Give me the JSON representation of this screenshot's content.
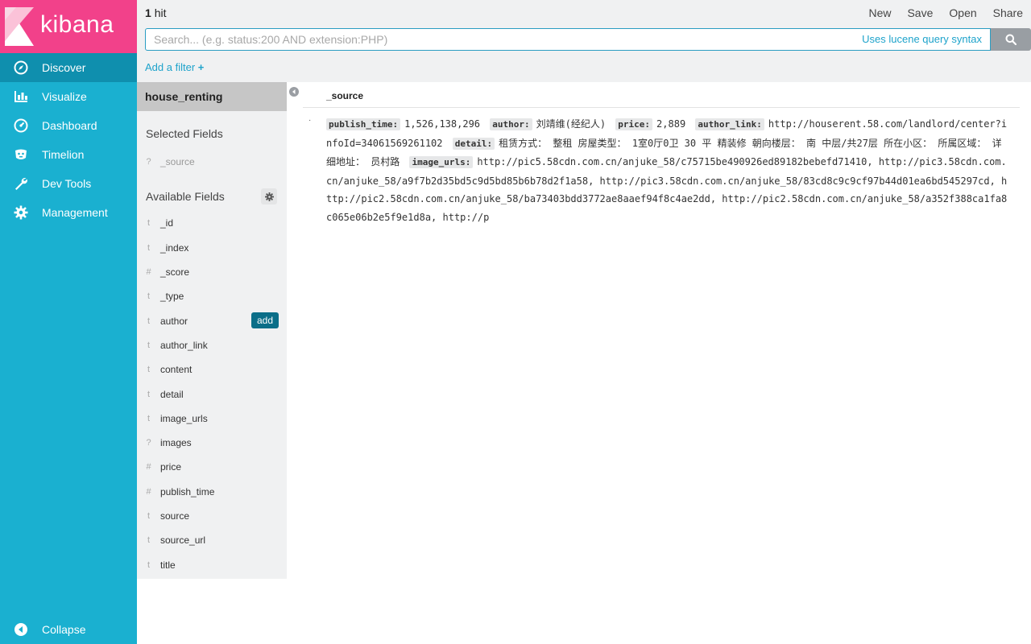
{
  "app": {
    "logo_text": "kibana"
  },
  "sidebar": {
    "items": [
      {
        "label": "Discover",
        "icon": "compass-icon",
        "active": true
      },
      {
        "label": "Visualize",
        "icon": "bar-chart-icon",
        "active": false
      },
      {
        "label": "Dashboard",
        "icon": "gauge-icon",
        "active": false
      },
      {
        "label": "Timelion",
        "icon": "timelion-icon",
        "active": false
      },
      {
        "label": "Dev Tools",
        "icon": "wrench-icon",
        "active": false
      },
      {
        "label": "Management",
        "icon": "gear-icon",
        "active": false
      }
    ],
    "collapse_label": "Collapse"
  },
  "topbar": {
    "hit_count": "1",
    "hit_label": "hit",
    "menu": {
      "new": "New",
      "save": "Save",
      "open": "Open",
      "share": "Share"
    },
    "search_placeholder": "Search... (e.g. status:200 AND extension:PHP)",
    "search_value": "",
    "lucene_label": "Uses lucene query syntax",
    "add_filter_label": "Add a filter"
  },
  "fields": {
    "index_pattern": "house_renting",
    "selected_title": "Selected Fields",
    "selected": [
      {
        "type": "?",
        "name": "_source"
      }
    ],
    "available_title": "Available Fields",
    "add_label": "add",
    "available": [
      {
        "type": "t",
        "name": "_id"
      },
      {
        "type": "t",
        "name": "_index"
      },
      {
        "type": "#",
        "name": "_score"
      },
      {
        "type": "t",
        "name": "_type"
      },
      {
        "type": "t",
        "name": "author"
      },
      {
        "type": "t",
        "name": "author_link"
      },
      {
        "type": "t",
        "name": "content"
      },
      {
        "type": "t",
        "name": "detail"
      },
      {
        "type": "t",
        "name": "image_urls"
      },
      {
        "type": "?",
        "name": "images"
      },
      {
        "type": "#",
        "name": "price"
      },
      {
        "type": "#",
        "name": "publish_time"
      },
      {
        "type": "t",
        "name": "source"
      },
      {
        "type": "t",
        "name": "source_url"
      },
      {
        "type": "t",
        "name": "title"
      }
    ]
  },
  "results": {
    "column_header": "_source",
    "document": [
      {
        "key": "publish_time:",
        "value": "1,526,138,296"
      },
      {
        "key": "author:",
        "value": "刘靖维(经纪人)"
      },
      {
        "key": "price:",
        "value": "2,889"
      },
      {
        "key": "author_link:",
        "value": "http://houserent.58.com/landlord/center?infoId=34061569261102"
      },
      {
        "key": "detail:",
        "value": "租赁方式： 整租 房屋类型： 1室0厅0卫 30 平 精装修 朝向楼层： 南 中层/共27层 所在小区： 所属区域： 详细地址： 员村路"
      },
      {
        "key": "image_urls:",
        "value": "http://pic5.58cdn.com.cn/anjuke_58/c75715be490926ed89182bebefd71410, http://pic3.58cdn.com.cn/anjuke_58/a9f7b2d35bd5c9d5bd85b6b78d2f1a58, http://pic3.58cdn.com.cn/anjuke_58/83cd8c9c9cf97b44d01ea6bd545297cd, http://pic2.58cdn.com.cn/anjuke_58/ba73403bdd3772ae8aaef94f8c4ae2dd, http://pic2.58cdn.com.cn/anjuke_58/a352f388ca1fa8c065e06b2e5f9e1d8a, http://p"
      }
    ]
  },
  "colors": {
    "sidebar": "#1ab0d0",
    "sidebar_active": "#0f8fae",
    "logo_bg": "#f2418a",
    "link": "#1ea3cb",
    "add_button": "#0b6e88"
  }
}
